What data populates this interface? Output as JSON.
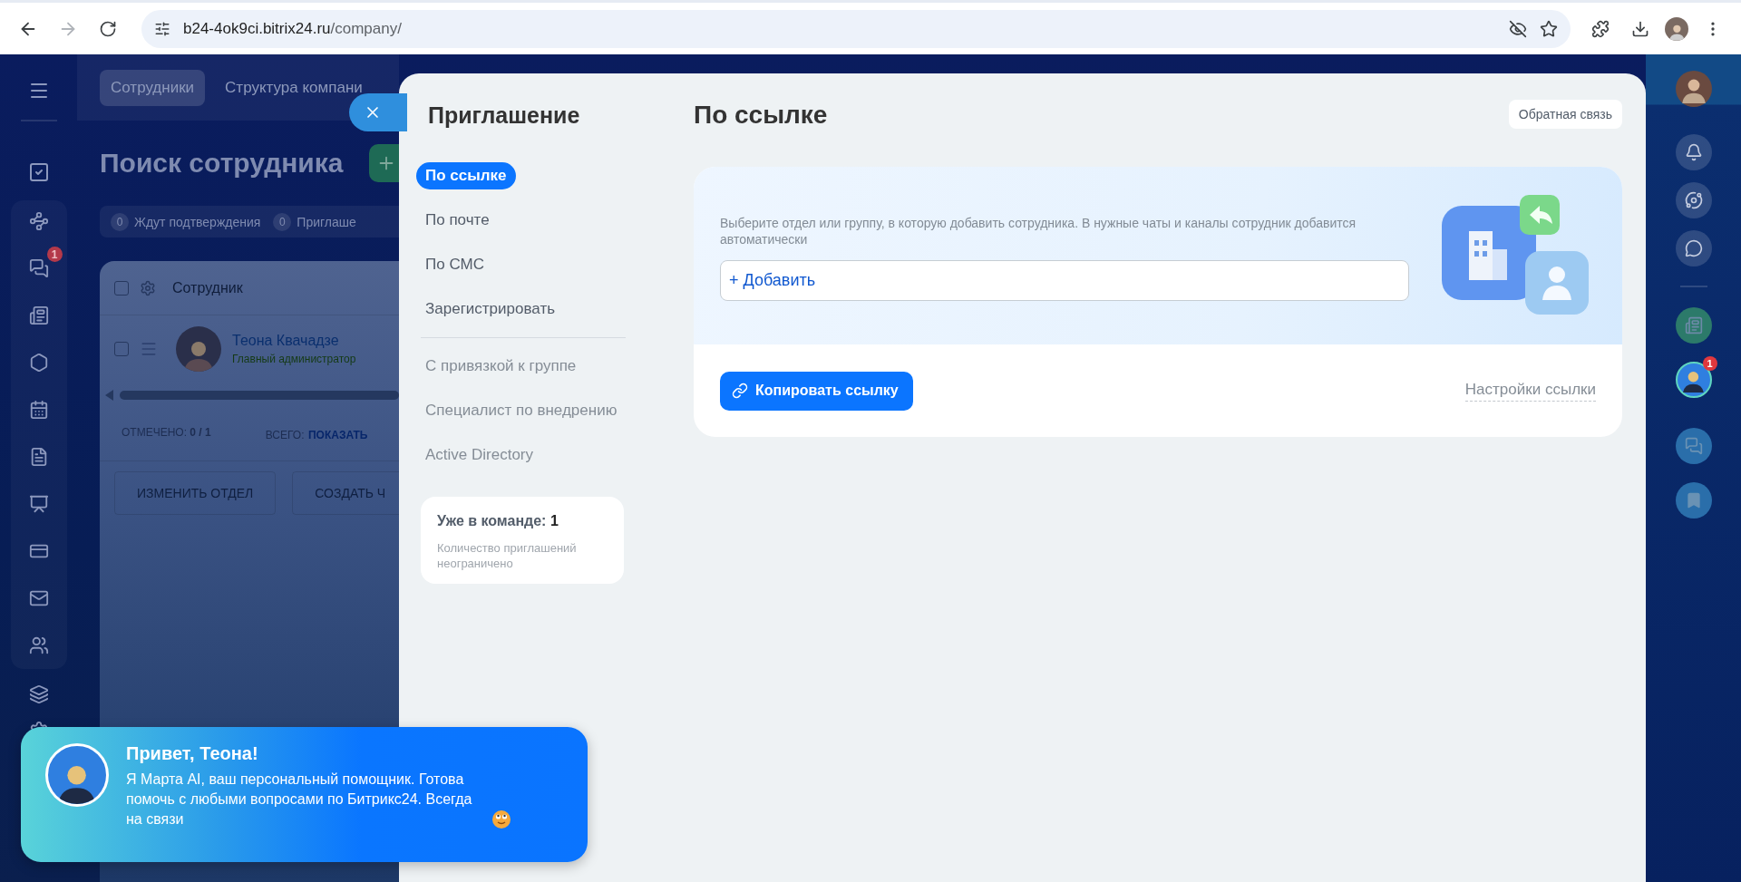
{
  "browser": {
    "url_host": "b24-4ok9ci.bitrix24.ru",
    "url_path": "/company/"
  },
  "left_rail": {
    "chat_badge": "1"
  },
  "background_page": {
    "tabs": [
      {
        "label": "Сотрудники",
        "selected": true
      },
      {
        "label": "Структура компани",
        "selected": false
      }
    ],
    "title": "Поиск сотрудника",
    "counters": [
      {
        "count": "0",
        "label": "Ждут подтверждения"
      },
      {
        "count": "0",
        "label": "Приглаше"
      }
    ],
    "table": {
      "header_checked": false,
      "column": "Сотрудник",
      "rows": [
        {
          "name": "Теона Квачадзе",
          "role": "Главный администратор",
          "checked": false
        }
      ]
    },
    "footer": {
      "selected_label": "ОТМЕЧЕНО:",
      "selected_value": "0 / 1",
      "total_label": "ВСЕГО:",
      "total_link": "ПОКАЗАТЬ"
    },
    "actions": [
      "ИЗМЕНИТЬ ОТДЕЛ",
      "СОЗДАТЬ Ч"
    ]
  },
  "modal": {
    "title": "Приглашение",
    "nav": [
      {
        "label": "По ссылке",
        "selected": true,
        "kind": "primary"
      },
      {
        "label": "По почте",
        "selected": false,
        "kind": "primary"
      },
      {
        "label": "По СМС",
        "selected": false,
        "kind": "primary"
      },
      {
        "label": "Зарегистрировать",
        "selected": false,
        "kind": "primary"
      },
      {
        "label": "С привязкой к группе",
        "selected": false,
        "kind": "secondary"
      },
      {
        "label": "Специалист по внедрению",
        "selected": false,
        "kind": "secondary"
      },
      {
        "label": "Active Directory",
        "selected": false,
        "kind": "secondary"
      }
    ],
    "team_card": {
      "label": "Уже в команде:",
      "count": "1",
      "note": "Количество приглашений неограничено"
    },
    "heading": "По ссылке",
    "feedback_button": "Обратная связь",
    "description": "Выберите отдел или группу, в которую добавить сотрудника. В нужные чаты и каналы сотрудник добавится автоматически",
    "add_link": "+ Добавить",
    "copy_button": "Копировать ссылку",
    "settings_link": "Настройки ссылки"
  },
  "right_rail": {
    "badge": "1"
  },
  "assistant_popup": {
    "title": "Привет, Теона!",
    "message": "Я Марта AI, ваш персональный помощник. Готова помочь с любыми вопросами по Битрикс24. Всегда на связи"
  }
}
